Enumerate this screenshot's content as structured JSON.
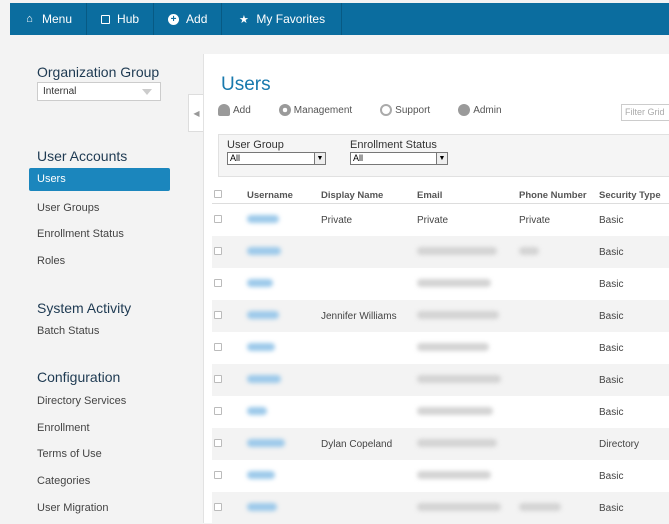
{
  "topbar": {
    "items": [
      {
        "label": "Menu",
        "icon": "home-icon"
      },
      {
        "label": "Hub",
        "icon": "square-icon"
      },
      {
        "label": "Add",
        "icon": "plus-circle-icon"
      },
      {
        "label": "My Favorites",
        "icon": "star-icon"
      }
    ]
  },
  "sidebar": {
    "org_group_title": "Organization Group",
    "org_group_value": "Internal",
    "user_accounts_title": "User Accounts",
    "user_accounts_items": [
      "Users",
      "User Groups",
      "Enrollment Status",
      "Roles"
    ],
    "system_activity_title": "System Activity",
    "system_activity_items": [
      "Batch Status"
    ],
    "configuration_title": "Configuration",
    "configuration_items": [
      "Directory Services",
      "Enrollment",
      "Terms of Use",
      "Categories",
      "User Migration"
    ]
  },
  "main": {
    "title": "Users",
    "toolbar": {
      "add": "Add",
      "management": "Management",
      "support": "Support",
      "admin": "Admin"
    },
    "filter_placeholder": "Filter Grid",
    "filters": {
      "user_group_label": "User Group",
      "user_group_value": "All",
      "enrollment_status_label": "Enrollment Status",
      "enrollment_status_value": "All"
    },
    "columns": [
      "Username",
      "Display Name",
      "Email",
      "Phone Number",
      "Security Type"
    ],
    "rows": [
      {
        "display_name": "Private",
        "email": "Private",
        "phone": "Private",
        "security": "Basic"
      },
      {
        "display_name": "",
        "email": "",
        "phone": "",
        "security": "Basic"
      },
      {
        "display_name": "",
        "email": "",
        "phone": "",
        "security": "Basic"
      },
      {
        "display_name": "Jennifer Williams",
        "email": "",
        "phone": "",
        "security": "Basic"
      },
      {
        "display_name": "",
        "email": "",
        "phone": "",
        "security": "Basic"
      },
      {
        "display_name": "",
        "email": "",
        "phone": "",
        "security": "Basic"
      },
      {
        "display_name": "",
        "email": "",
        "phone": "",
        "security": "Basic"
      },
      {
        "display_name": "Dylan Copeland",
        "email": "",
        "phone": "",
        "security": "Directory"
      },
      {
        "display_name": "",
        "email": "",
        "phone": "",
        "security": "Basic"
      },
      {
        "display_name": "",
        "email": "",
        "phone": "",
        "security": "Basic"
      }
    ]
  }
}
